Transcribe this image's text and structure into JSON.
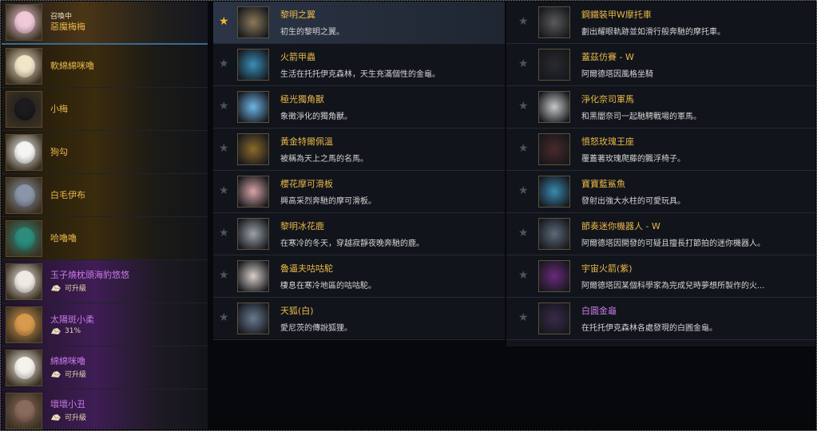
{
  "pets": [
    {
      "name": "惡魔梅梅",
      "status": "召喚中",
      "tier": "summoned",
      "bg": "#f0c8d8"
    },
    {
      "name": "軟綿綿咪嚕",
      "tier": "gold",
      "bg": "#f2e6c9"
    },
    {
      "name": "小梅",
      "tier": "gold",
      "bg": "#1b1b1e"
    },
    {
      "name": "狗勾",
      "tier": "gold",
      "bg": "#f4f4f2"
    },
    {
      "name": "白毛伊布",
      "tier": "gold",
      "bg": "#8a96a8"
    },
    {
      "name": "哈嚕嚕",
      "tier": "gold",
      "bg": "#2d8c7c"
    },
    {
      "name": "玉子燒枕頭海豹悠悠",
      "tier": "purple",
      "bg": "#efeae4",
      "tag": "可升級"
    },
    {
      "name": "太陽斑小柔",
      "tier": "purple",
      "bg": "#d89a4e",
      "tag": "31%"
    },
    {
      "name": "綿綿咪嚕",
      "tier": "purple",
      "bg": "#f6f3ee",
      "tag": "可升級"
    },
    {
      "name": "壞壞小丑",
      "tier": "purple",
      "bg": "#8a6a5a",
      "tag": "可升級"
    }
  ],
  "mounts_mid": [
    {
      "name": "黎明之翼",
      "desc": "初生的黎明之翼。",
      "fav": true,
      "selected": true,
      "bg": "#8a7a5a",
      "rarity": "gold"
    },
    {
      "name": "火箭甲蟲",
      "desc": "生活在托托伊克森林，天生充滿個性的金龜。",
      "fav": false,
      "bg": "#3a8eb8",
      "rarity": "gold"
    },
    {
      "name": "極光獨角獸",
      "desc": "象徵淨化的獨角獸。",
      "fav": false,
      "bg": "#6fb5e6",
      "rarity": "gold"
    },
    {
      "name": "黃金特爾佩溫",
      "desc": "被稱為天上之馬的名馬。",
      "fav": false,
      "bg": "#8d6a2a",
      "rarity": "gold"
    },
    {
      "name": "櫻花摩可滑板",
      "desc": "興高采烈奔馳的摩可滑板。",
      "fav": false,
      "bg": "#d9a5a8",
      "rarity": "gold"
    },
    {
      "name": "黎明冰花鹿",
      "desc": "在寒冷的冬天，穿越寂靜夜晚奔馳的鹿。",
      "fav": false,
      "bg": "#9aa2a8",
      "rarity": "gold"
    },
    {
      "name": "魯逼夫咕咕駝",
      "desc": "棲息在寒冷地區的咕咕駝。",
      "fav": false,
      "bg": "#d8cfc8",
      "rarity": "gold"
    },
    {
      "name": "天狐(白)",
      "desc": "愛尼茨的傳說狐狸。",
      "fav": false,
      "bg": "#6a7a90",
      "rarity": "gold"
    }
  ],
  "mounts_right": [
    {
      "name": "鋼鐵裝甲W摩托車",
      "desc": "劃出耀眼軌跡並如滑行般奔馳的摩托車。",
      "fav": false,
      "bg": "#5a5a5a",
      "rarity": "gold"
    },
    {
      "name": "蓋茲仿賽 - W",
      "desc": "阿爾德塔因風格坐騎",
      "fav": false,
      "bg": "#2a2a2e",
      "rarity": "gold"
    },
    {
      "name": "淨化奈司軍馬",
      "desc": "和黑闇奈司一起馳騁戰場的軍馬。",
      "fav": false,
      "bg": "#c8c8c8",
      "rarity": "gold"
    },
    {
      "name": "憤怒玫瑰王座",
      "desc": "覆蓋著玫瑰爬藤的飄浮椅子。",
      "fav": false,
      "bg": "#4a2a2a",
      "rarity": "gold"
    },
    {
      "name": "寶寶藍鯊魚",
      "desc": "發射出強大水柱的可愛玩具。",
      "fav": false,
      "bg": "#3a8ab0",
      "rarity": "gold"
    },
    {
      "name": "節奏迷你機器人 - W",
      "desc": "阿爾德塔因開發的可疑且擅長打節拍的迷你機器人。",
      "fav": false,
      "bg": "#5a6a7a",
      "rarity": "gold"
    },
    {
      "name": "宇宙火箭(紫)",
      "desc": "阿爾德塔因某個科學家為完成兒時夢想所製作的火...",
      "fav": false,
      "bg": "#6a2a7a",
      "rarity": "gold"
    },
    {
      "name": "白圓金龜",
      "desc": "在托托伊克森林各處發現的白圓金龜。",
      "fav": false,
      "bg": "#3a2a4a",
      "rarity": "purple"
    }
  ],
  "colors": {
    "gold_text": "#e9b84a",
    "purple_text": "#c77be6",
    "star_on": "#f0b431",
    "star_off": "#4d535e"
  },
  "icons": {
    "favorite": "star-icon",
    "upgradable": "upgrade-stone-icon"
  }
}
